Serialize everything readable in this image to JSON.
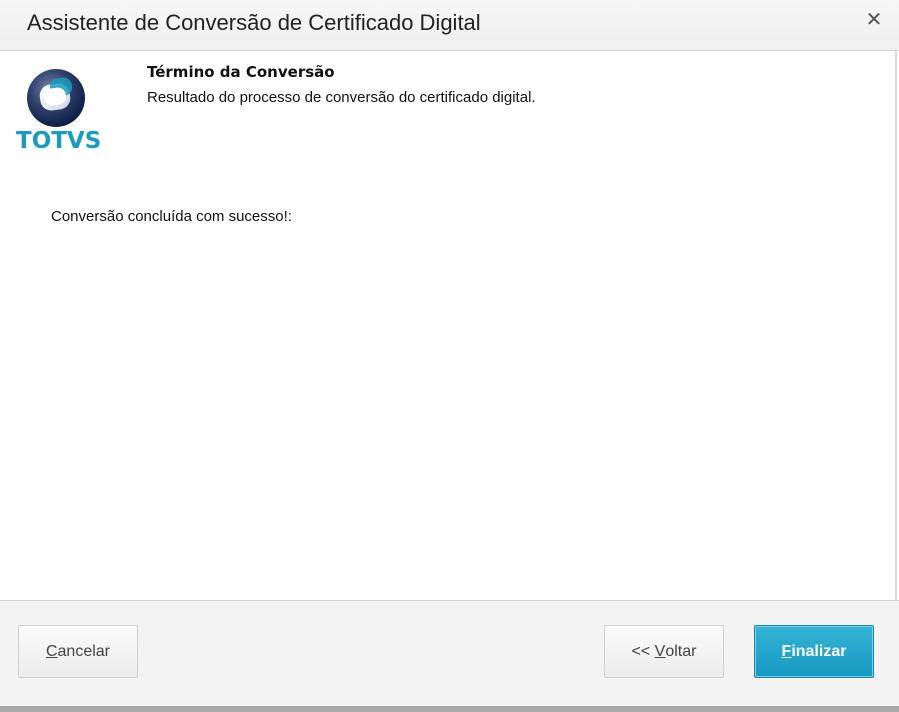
{
  "window": {
    "title": "Assistente de Conversão de Certificado Digital",
    "close_glyph": "✕"
  },
  "logo": {
    "text": "TOTVS",
    "brand_color": "#1b9bc0"
  },
  "step": {
    "title": "Término da Conversão",
    "subtitle": "Resultado do processo de conversão do certificado digital."
  },
  "message": "Conversão concluída com sucesso!:",
  "buttons": {
    "cancel": {
      "mnemonic": "C",
      "rest": "ancelar"
    },
    "back": {
      "prefix": "<< ",
      "mnemonic": "V",
      "rest": "oltar"
    },
    "finish": {
      "mnemonic": "F",
      "rest": "inalizar",
      "color": "#1699c1"
    }
  }
}
